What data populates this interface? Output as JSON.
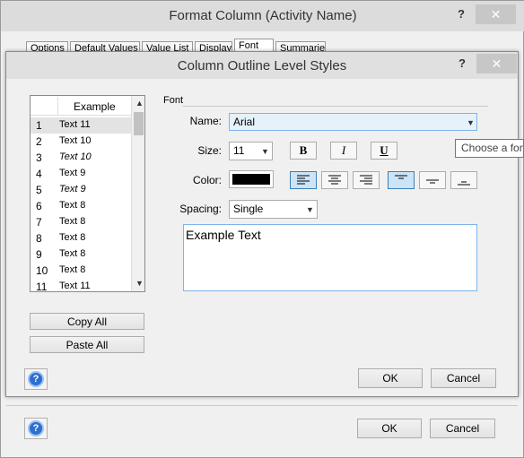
{
  "outer": {
    "title": "Format Column (Activity Name)",
    "help_label": "?",
    "close_label": "✕",
    "tabs": [
      {
        "label": "Options"
      },
      {
        "label": "Default Values"
      },
      {
        "label": "Value List"
      },
      {
        "label": "Display"
      },
      {
        "label": "Font"
      },
      {
        "label": "Summaries"
      }
    ],
    "ok_label": "OK",
    "cancel_label": "Cancel"
  },
  "dialog": {
    "title": "Column Outline Level Styles",
    "help_label": "?",
    "close_label": "✕",
    "list": {
      "header": "Example",
      "rows": [
        {
          "num": "1",
          "text": "Text 11",
          "italic": false
        },
        {
          "num": "2",
          "text": "Text 10",
          "italic": false
        },
        {
          "num": "3",
          "text": "Text 10",
          "italic": true
        },
        {
          "num": "4",
          "text": "Text 9",
          "italic": false
        },
        {
          "num": "5",
          "text": "Text 9",
          "italic": true
        },
        {
          "num": "6",
          "text": "Text 8",
          "italic": false
        },
        {
          "num": "7",
          "text": "Text 8",
          "italic": false
        },
        {
          "num": "8",
          "text": "Text 8",
          "italic": false
        },
        {
          "num": "9",
          "text": "Text 8",
          "italic": false
        },
        {
          "num": "10",
          "text": "Text 8",
          "italic": false
        },
        {
          "num": "11",
          "text": "Text 11",
          "italic": false
        }
      ]
    },
    "copy_all_label": "Copy All",
    "paste_all_label": "Paste All",
    "font_section": "Font",
    "name_label": "Name:",
    "name_value": "Arial",
    "size_label": "Size:",
    "size_value": "11",
    "bold_label": "B",
    "italic_label": "I",
    "underline_label": "U",
    "color_label": "Color:",
    "color_value": "#000000",
    "spacing_label": "Spacing:",
    "spacing_value": "Single",
    "example_text": "Example Text",
    "tooltip": "Choose a font",
    "ok_label": "OK",
    "cancel_label": "Cancel"
  }
}
